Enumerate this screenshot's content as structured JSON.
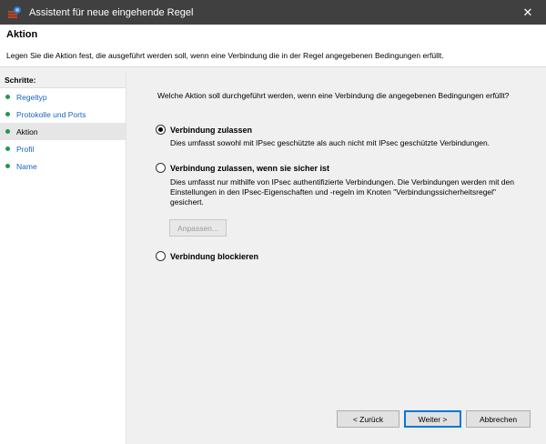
{
  "window": {
    "title": "Assistent für neue eingehende Regel",
    "close_symbol": "✕"
  },
  "header": {
    "title": "Aktion",
    "description": "Legen Sie die Aktion fest, die ausgeführt werden soll, wenn eine Verbindung die in der Regel angegebenen Bedingungen erfüllt."
  },
  "steps": {
    "title": "Schritte:",
    "items": [
      {
        "label": "Regeltyp"
      },
      {
        "label": "Protokolle und Ports"
      },
      {
        "label": "Aktion"
      },
      {
        "label": "Profil"
      },
      {
        "label": "Name"
      }
    ]
  },
  "main": {
    "question": "Welche Aktion soll durchgeführt werden, wenn eine Verbindung die angegebenen Bedingungen erfüllt?",
    "options": [
      {
        "label": "Verbindung zulassen",
        "description": "Dies umfasst sowohl mit IPsec geschützte als auch nicht mit IPsec geschützte Verbindungen.",
        "checked": true
      },
      {
        "label": "Verbindung zulassen, wenn sie sicher ist",
        "description": "Dies umfasst nur mithilfe von IPsec authentifizierte Verbindungen. Die Verbindungen werden mit den Einstellungen in den IPsec-Eigenschaften und -regeln im Knoten \"Verbindungssicherheitsregel\" gesichert.",
        "checked": false
      },
      {
        "label": "Verbindung blockieren",
        "description": "",
        "checked": false
      }
    ],
    "customize_button": "Anpassen..."
  },
  "footer": {
    "back": "< Zurück",
    "next": "Weiter >",
    "cancel": "Abbrechen"
  },
  "colors": {
    "titlebar": "#404040",
    "link": "#1a63c2",
    "step_dot": "#1f9a4a",
    "focus": "#0078d7"
  }
}
